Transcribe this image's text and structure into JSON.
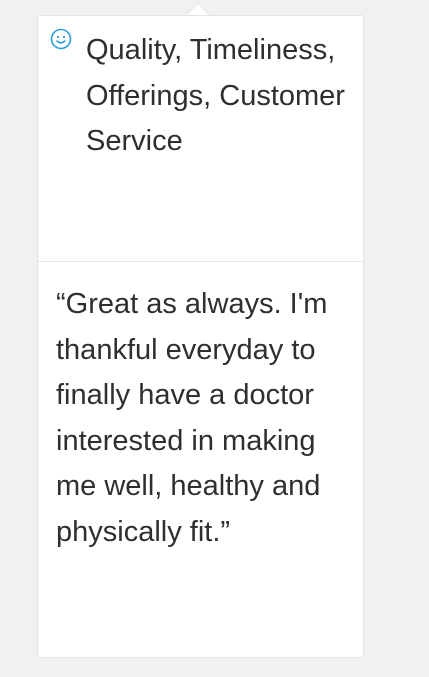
{
  "review_card": {
    "categories": "Quality, Timeliness, Offerings, Customer Service",
    "quote": "“Great as always. I'm thankful everyday to finally have a doctor interested in making me well, healthy and physically fit.”",
    "icon": "smiley-icon",
    "icon_color": "#2a9fd8"
  }
}
